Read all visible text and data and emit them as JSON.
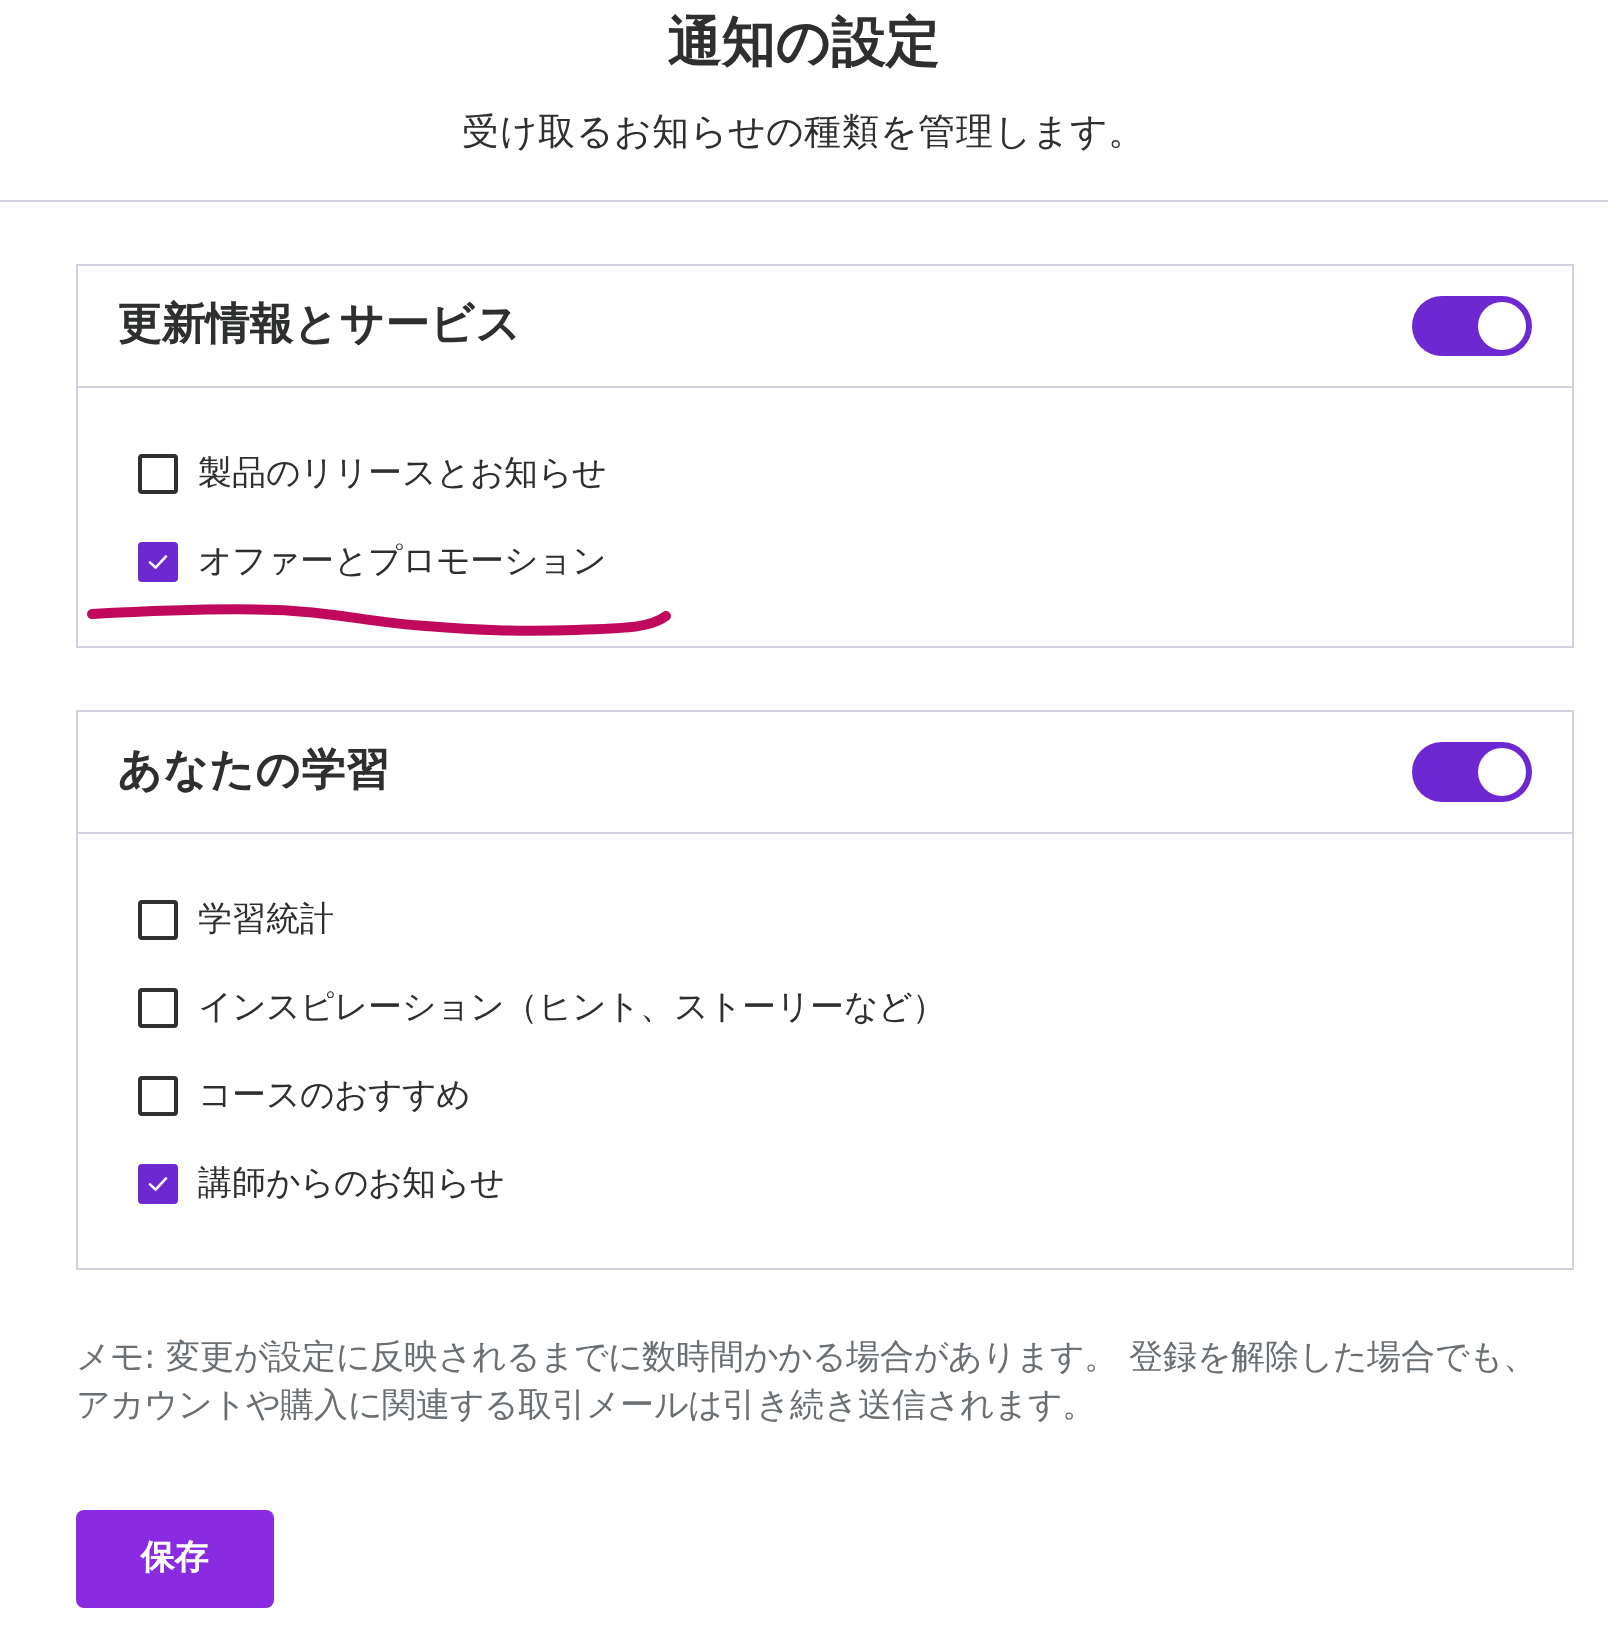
{
  "page": {
    "title": "通知の設定",
    "subtitle": "受け取るお知らせの種類を管理します。"
  },
  "sections": [
    {
      "title": "更新情報とサービス",
      "on": true,
      "options": [
        {
          "label": "製品のリリースとお知らせ",
          "checked": false,
          "underlined": false
        },
        {
          "label": "オファーとプロモーション",
          "checked": true,
          "underlined": true
        }
      ]
    },
    {
      "title": "あなたの学習",
      "on": true,
      "options": [
        {
          "label": "学習統計",
          "checked": false,
          "underlined": false
        },
        {
          "label": "インスピレーション（ヒント、ストーリーなど）",
          "checked": false,
          "underlined": false
        },
        {
          "label": "コースのおすすめ",
          "checked": false,
          "underlined": false
        },
        {
          "label": "講師からのお知らせ",
          "checked": true,
          "underlined": false
        }
      ]
    }
  ],
  "note": "メモ: 変更が設定に反映されるまでに数時間かかる場合があります。 登録を解除した場合でも、アカウントや購入に関連する取引メールは引き続き送信されます。",
  "save_button": "保存"
}
